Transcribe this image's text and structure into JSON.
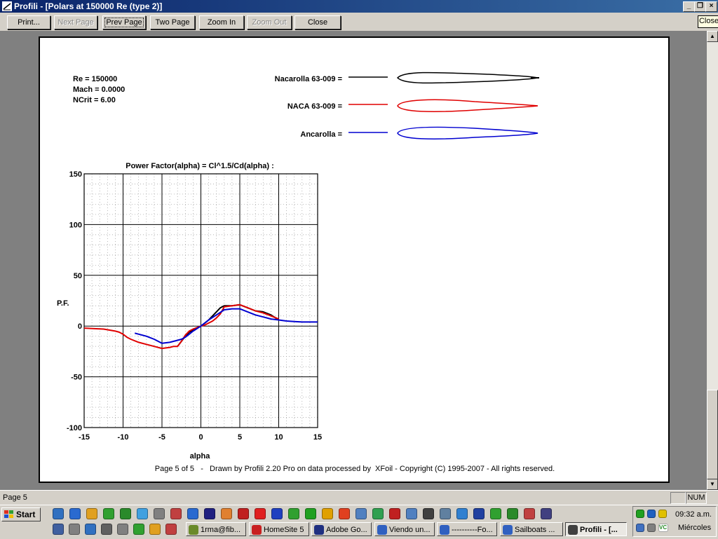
{
  "window": {
    "title": "Profili - [Polars at 150000 Re (type 2)]"
  },
  "toolbar": {
    "print": "Print...",
    "next_page": "Next Page",
    "prev_page": "Prev Page",
    "two_page": "Two Page",
    "zoom_in": "Zoom In",
    "zoom_out": "Zoom Out",
    "close": "Close",
    "close_tooltip": "Close"
  },
  "report": {
    "params": [
      "Re = 150000",
      "Mach = 0.0000",
      "NCrit = 6.00"
    ],
    "legend": [
      {
        "label": "Nacarolla 63-009 =",
        "color": "#000000"
      },
      {
        "label": "NACA 63-009 =",
        "color": "#e00000"
      },
      {
        "label": "Ancarolla =",
        "color": "#0000d0"
      }
    ],
    "footer": "Page 5 of 5   -   Drawn by Profili 2.20 Pro on data processed by  XFoil - Copyright (C) 1995-2007 - All rights reserved."
  },
  "chart_data": {
    "type": "line",
    "title": "Power Factor(alpha) = Cl^1.5/Cd(alpha) :",
    "xlabel": "alpha",
    "ylabel": "P.F.",
    "xlim": [
      -15,
      15
    ],
    "ylim": [
      -100,
      150
    ],
    "xticks": [
      -15,
      -10,
      -5,
      0,
      5,
      10,
      15
    ],
    "yticks": [
      150,
      100,
      50,
      0,
      -50,
      -100
    ],
    "grid": true,
    "series": [
      {
        "name": "Nacarolla 63-009",
        "color": "#000000",
        "x": [
          -3,
          -2.5,
          -2,
          -1.5,
          -1,
          -0.5,
          0,
          0.5,
          1,
          1.5,
          2,
          2.5,
          3,
          4,
          5,
          6,
          7,
          8,
          9,
          10
        ],
        "y": [
          -20,
          -15,
          -10,
          -6,
          -4,
          -2,
          0,
          3,
          6,
          10,
          14,
          18,
          20,
          20,
          21,
          18,
          15,
          14,
          11,
          6
        ]
      },
      {
        "name": "NACA 63-009",
        "color": "#e00000",
        "x": [
          -15,
          -12.5,
          -11,
          -10.5,
          -10,
          -9.5,
          -9,
          -8,
          -7,
          -6,
          -5,
          -4,
          -3.5,
          -3,
          -2.5,
          -2,
          -1.5,
          -1,
          0,
          0.5,
          1,
          1.5,
          2,
          2.5,
          3,
          4,
          5,
          6,
          7,
          8,
          9,
          10
        ],
        "y": [
          -2,
          -3,
          -5,
          -6,
          -8,
          -11,
          -13,
          -16,
          -18,
          -20,
          -22,
          -21,
          -20,
          -20,
          -15,
          -9,
          -5,
          -3,
          0,
          1,
          3,
          5,
          8,
          12,
          19,
          20,
          21,
          18,
          15,
          13,
          10,
          7
        ]
      },
      {
        "name": "Ancarolla",
        "color": "#0000d0",
        "x": [
          -8.5,
          -7,
          -6,
          -5,
          -4,
          -3,
          -2.5,
          -2,
          -1.5,
          -1,
          0,
          1,
          2,
          3,
          4,
          5,
          6,
          7,
          8,
          9,
          10,
          11,
          12,
          13,
          14,
          15
        ],
        "y": [
          -7,
          -10,
          -13,
          -17,
          -16,
          -14,
          -13,
          -11,
          -8,
          -5,
          0,
          6,
          11,
          16,
          17,
          17,
          14,
          11,
          9,
          7,
          6,
          5,
          4.5,
          4,
          4,
          4
        ]
      }
    ]
  },
  "statusbar": {
    "page": "Page 5",
    "num": "NUM"
  },
  "taskbar": {
    "start": "Start",
    "tasks": [
      {
        "label": "1rma@fib...",
        "color": "#6a8a2a",
        "active": false
      },
      {
        "label": "HomeSite 5",
        "color": "#c82020",
        "active": false
      },
      {
        "label": "Adobe Go...",
        "color": "#203080",
        "active": false
      },
      {
        "label": "Viendo un...",
        "color": "#3060c0",
        "active": false
      },
      {
        "label": "----------Fo...",
        "color": "#3060c0",
        "active": false
      },
      {
        "label": "Sailboats ...",
        "color": "#3060c0",
        "active": false
      },
      {
        "label": "Profili - [...",
        "color": "#404040",
        "active": true
      }
    ],
    "clock": "09:32 a.m.",
    "day": "Miércoles"
  }
}
